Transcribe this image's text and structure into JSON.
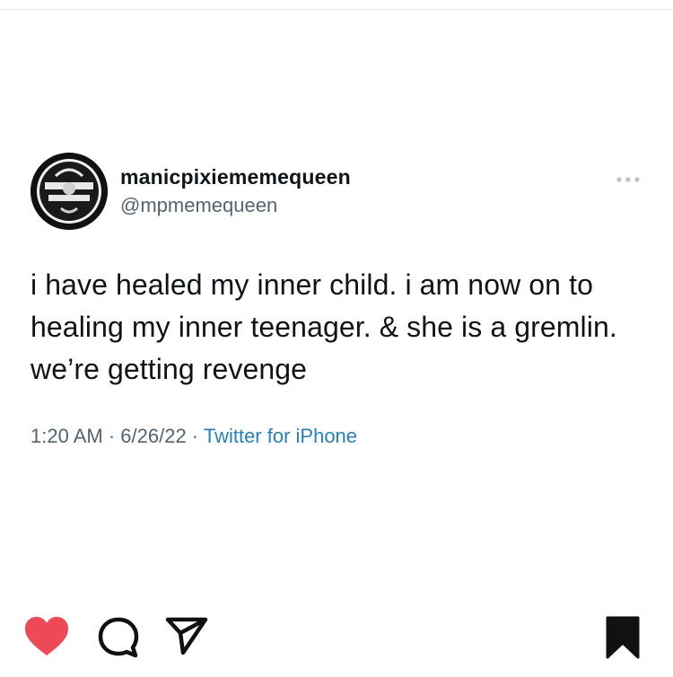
{
  "tweet": {
    "display_name": "manicpixiememequeen",
    "handle": "@mpmemequeen",
    "text": "i have healed my inner child. i am now on to healing my inner teenager. & she is a gremlin. we’re getting revenge",
    "time": "1:20 AM",
    "separator": " · ",
    "date": "6/26/22",
    "source": "Twitter for iPhone",
    "more_icon": "ellipsis-icon",
    "avatar_icon": "profile-avatar"
  },
  "post_actions": {
    "like": {
      "icon": "heart-icon",
      "liked": true,
      "color": "#ed4956"
    },
    "comment": {
      "icon": "comment-icon"
    },
    "share": {
      "icon": "send-icon"
    },
    "save": {
      "icon": "bookmark-icon",
      "saved": true
    }
  },
  "colors": {
    "text": "#0f1419",
    "secondary": "#536471",
    "link": "#2a7fb8",
    "like": "#ed4956"
  }
}
